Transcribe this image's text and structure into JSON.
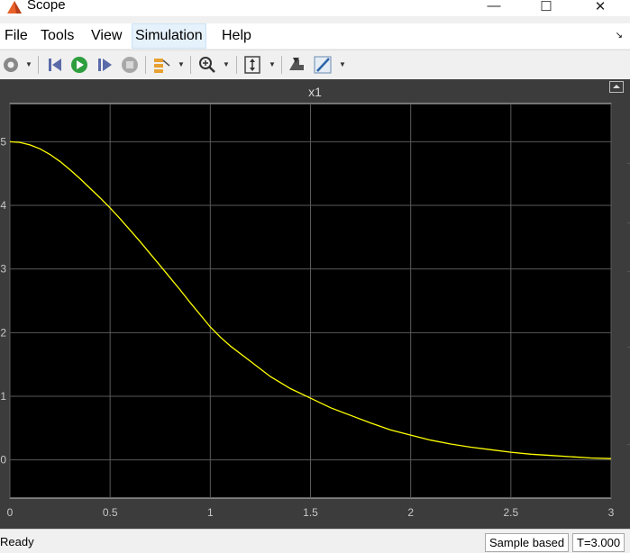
{
  "window": {
    "title": "Scope"
  },
  "menu": [
    "File",
    "Tools",
    "View",
    "Simulation",
    "Help"
  ],
  "toolbar": {
    "icons": [
      "gear-icon",
      "step-back-icon",
      "run-icon",
      "step-forward-icon",
      "stop-icon",
      "signal-selector-icon",
      "zoom-in-icon",
      "autoscale-icon",
      "highlight-block-icon",
      "style-icon"
    ]
  },
  "plot": {
    "title": "x1",
    "background": "#000000",
    "line_color": "#ffff00"
  },
  "status": {
    "text": "Ready",
    "mode": "Sample based",
    "time": "T=3.000"
  },
  "chart_data": {
    "type": "line",
    "title": "x1",
    "x_ticks": [
      "0",
      "0.5",
      "1",
      "1.5",
      "2",
      "2.5",
      "3"
    ],
    "y_ticks": [
      "0",
      "1",
      "2",
      "3",
      "4",
      "5"
    ],
    "xlim": [
      0,
      3
    ],
    "ylim": [
      -0.6,
      5.6
    ],
    "grid": true,
    "series": [
      {
        "x": [
          0,
          0.05,
          0.1,
          0.15,
          0.2,
          0.25,
          0.3,
          0.35,
          0.4,
          0.45,
          0.5,
          0.55,
          0.6,
          0.65,
          0.7,
          0.75,
          0.8,
          0.85,
          0.9,
          0.95,
          1.0,
          1.05,
          1.1,
          1.2,
          1.3,
          1.4,
          1.5,
          1.6,
          1.7,
          1.8,
          1.9,
          2.0,
          2.1,
          2.2,
          2.3,
          2.4,
          2.5,
          2.6,
          2.7,
          2.8,
          2.9,
          3.0
        ],
        "y": [
          5.0,
          4.99,
          4.95,
          4.89,
          4.8,
          4.69,
          4.56,
          4.42,
          4.27,
          4.12,
          3.96,
          3.79,
          3.61,
          3.43,
          3.24,
          3.05,
          2.86,
          2.67,
          2.47,
          2.28,
          2.09,
          1.93,
          1.79,
          1.55,
          1.31,
          1.12,
          0.97,
          0.82,
          0.7,
          0.58,
          0.47,
          0.39,
          0.31,
          0.25,
          0.2,
          0.16,
          0.12,
          0.09,
          0.07,
          0.05,
          0.03,
          0.02
        ]
      }
    ]
  }
}
